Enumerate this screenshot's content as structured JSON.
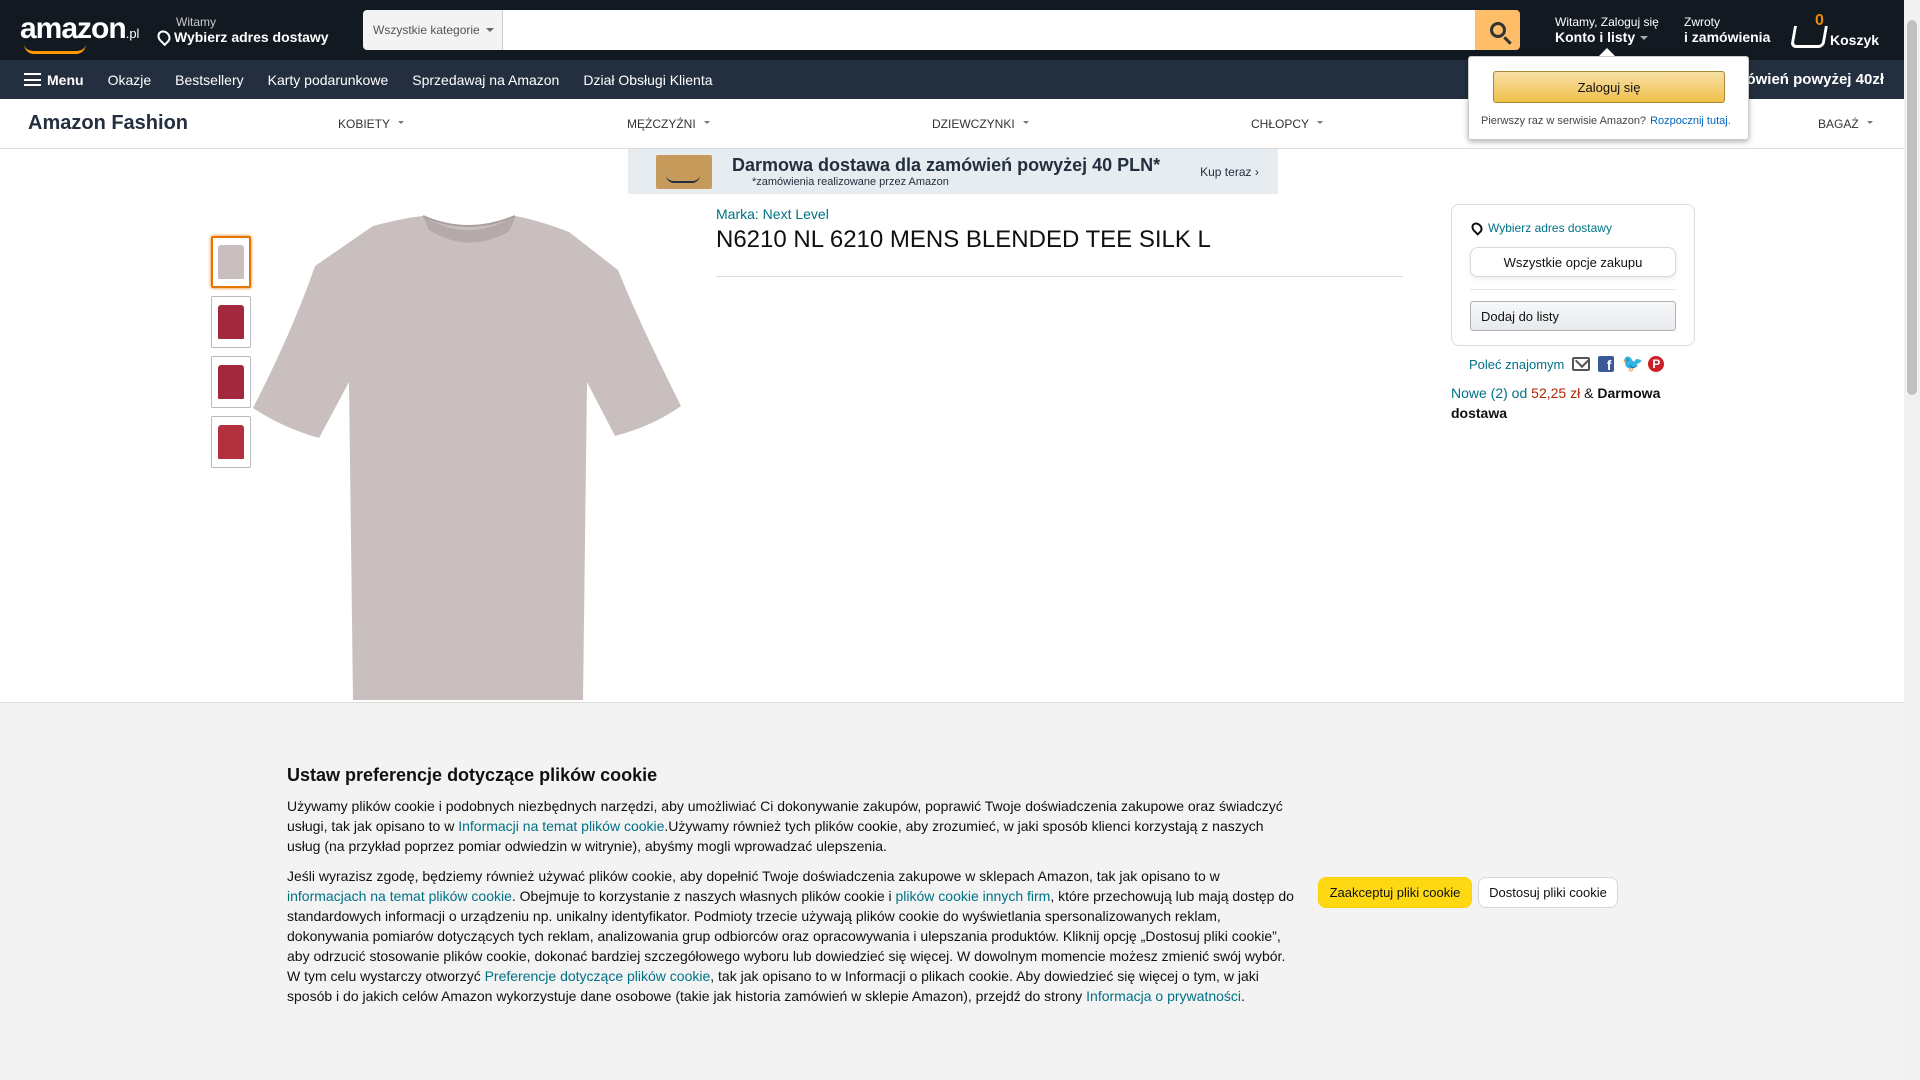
{
  "header": {
    "logo_text": "amazon",
    "logo_tld": ".pl",
    "deliver_small": "Witamy",
    "deliver_big": "Wybierz adres dostawy",
    "search_category": "Wszystkie kategorie",
    "search_placeholder": "",
    "account_small": "Witamy, Zaloguj się",
    "account_big": "Konto i listy",
    "returns_small": "Zwroty",
    "returns_big": "i zamówienia",
    "cart_count": "0",
    "cart_label": "Koszyk"
  },
  "nav": {
    "menu_label": "Menu",
    "items": [
      "Okazje",
      "Bestsellery",
      "Karty podarunkowe",
      "Sprzedawaj na Amazon",
      "Dział Obsługi Klienta"
    ],
    "promo": "Darmowa dostawa dla zamówień powyżej 40zł"
  },
  "fashion": {
    "brand": "Amazon Fashion",
    "items": [
      "KOBIETY",
      "MĘŻCZYŹNI",
      "DZIEWCZYNKI",
      "CHŁOPCY",
      "BAGAŻ"
    ]
  },
  "banner": {
    "title": "Darmowa dostawa dla zamówień powyżej 40 PLN*",
    "subtitle": "*zamówienia realizowane przez Amazon",
    "cta": "Kup teraz ›"
  },
  "product": {
    "brand_link": "Marka: Next Level",
    "title": "N6210 NL 6210 MENS BLENDED TEE SILK L",
    "main_color": "#c9bfbe",
    "thumbnails": [
      {
        "color": "#c9bfbe"
      },
      {
        "color": "#a3283d"
      },
      {
        "color": "#a3283d"
      },
      {
        "color": "#b3303e"
      }
    ]
  },
  "buybox": {
    "deliver_link": "Wybierz adres dostawy",
    "all_options": "Wszystkie opcje zakupu",
    "add_to_list": "Dodaj do listy"
  },
  "share": {
    "label": "Poleć znajomym",
    "icons": [
      "mail-icon",
      "facebook-icon",
      "twitter-icon",
      "pinterest-icon"
    ]
  },
  "offers": {
    "prefix": "Nowe (2) od",
    "price": "52,25 zł",
    "amp": "&",
    "delivery": "Darmowa dostawa"
  },
  "account_popup": {
    "signin": "Zaloguj się",
    "new_customer": "Pierwszy raz w serwisie Amazon?",
    "start_link": "Rozpocznij tutaj."
  },
  "cookie": {
    "title": "Ustaw preferencje dotyczące plików cookie",
    "p1_a": "Używamy plików cookie i podobnych niezbędnych narzędzi, aby umożliwiać Ci dokonywanie zakupów, poprawić Twoje doświadczenia zakupowe oraz świadczyć usługi, tak jak opisano to w ",
    "p1_link": "Informacji na temat plików cookie",
    "p1_b": ".Używamy również tych plików cookie, aby zrozumieć, w jaki sposób klienci korzystają z naszych usług (na przykład poprzez pomiar odwiedzin w witrynie), abyśmy mogli wprowadzać ulepszenia.",
    "p2_a": "Jeśli wyrazisz zgodę, będziemy również używać plików cookie, aby dopełnić Twoje doświadczenia zakupowe w sklepach Amazon, tak jak opisano to w ",
    "p2_link1": "informacjach na temat plików cookie",
    "p2_b": ". Obejmuje to korzystanie z naszych własnych plików cookie i ",
    "p2_link2": "plików cookie innych firm",
    "p2_c": ", które przechowują lub mają dostęp do standardowych informacji o urządzeniu np. unikalny identyfikator. Podmioty trzecie używają plików cookie do wyświetlania spersonalizowanych reklam, dokonywania pomiarów dotyczących tych reklam, analizowania grup odbiorców oraz opracowywania i ulepszania produktów. Kliknij opcję „Dostosuj pliki cookie”, aby odrzucić stosowanie plików cookie, dokonać bardziej szczegółowego wyboru lub dowiedzieć się więcej. W dowolnym momencie możesz zmienić swój wybór. W tym celu wystarczy otworzyć ",
    "p2_link3": "Preferencje dotyczące plików cookie",
    "p2_d": ", tak jak opisano to w Informacji o plikach cookie. Aby dowiedzieć się więcej o tym, w jaki sposób i do jakich celów Amazon wykorzystuje dane osobowe (takie jak historia zamówień w sklepie Amazon), przejdź do strony ",
    "p2_link4": "Informacja o prywatności",
    "p2_e": ".",
    "accept": "Zaakceptuj pliki cookie",
    "customize": "Dostosuj pliki cookie"
  }
}
